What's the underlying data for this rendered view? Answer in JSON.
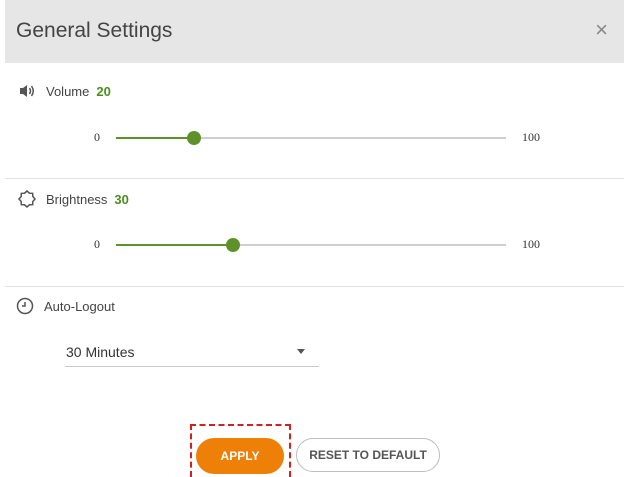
{
  "dialog": {
    "title": "General Settings",
    "close_symbol": "×"
  },
  "volume": {
    "label": "Volume",
    "value": 20,
    "value_text": "20",
    "min": "0",
    "max": "100",
    "icon": "speaker-icon"
  },
  "brightness": {
    "label": "Brightness",
    "value": 30,
    "value_text": "30",
    "min": "0",
    "max": "100",
    "icon": "brightness-icon"
  },
  "auto_logout": {
    "label": "Auto-Logout",
    "selected": "30 Minutes",
    "icon": "clock-icon"
  },
  "buttons": {
    "apply": "APPLY",
    "reset": "RESET TO DEFAULT"
  },
  "colors": {
    "accent_green": "#5e9129",
    "apply_orange": "#ee8008",
    "highlight_red": "#d62020"
  }
}
